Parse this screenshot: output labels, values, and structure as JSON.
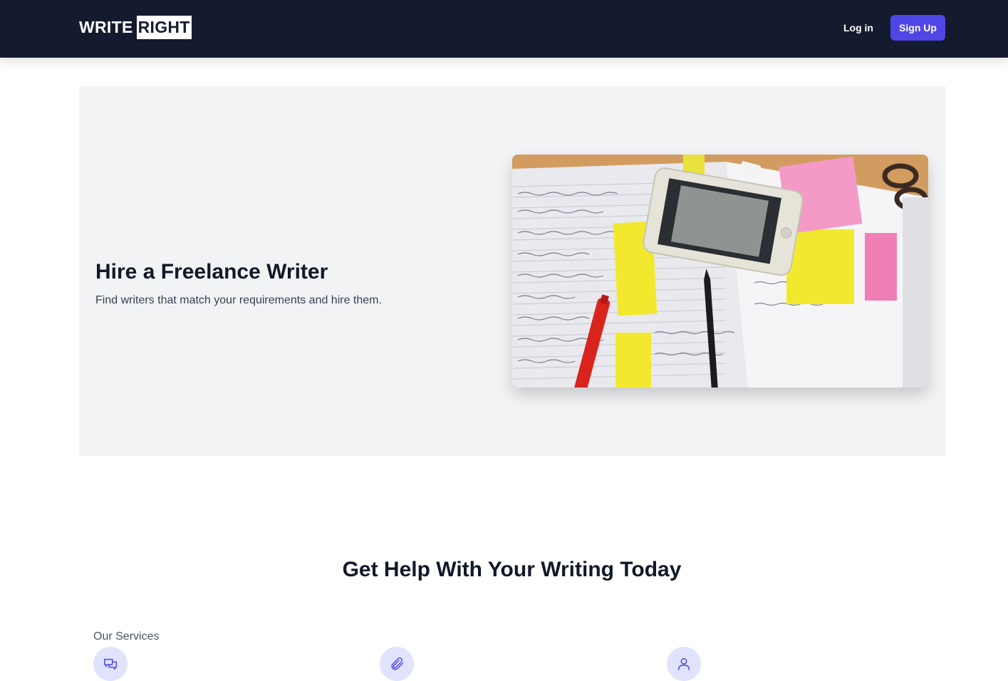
{
  "header": {
    "logo": {
      "word1": "WRITE",
      "word2": "RIGHT"
    },
    "login_label": "Log in",
    "signup_label": "Sign Up"
  },
  "hero": {
    "title": "Hire a Freelance Writer",
    "subtitle": "Find writers that match your requirements and hire them.",
    "image_icon": "desk-notes-photo"
  },
  "services_section": {
    "title": "Get Help With Your Writing Today",
    "label": "Our Services",
    "icons": [
      "chat-bubbles-icon",
      "paperclip-icon",
      "user-icon"
    ]
  },
  "colors": {
    "nav_bg": "#151b2e",
    "accent": "#4f46e5",
    "hero_bg": "#f2f3f5",
    "icon_bg": "#e0e3fb",
    "icon_stroke": "#4f46e5"
  }
}
